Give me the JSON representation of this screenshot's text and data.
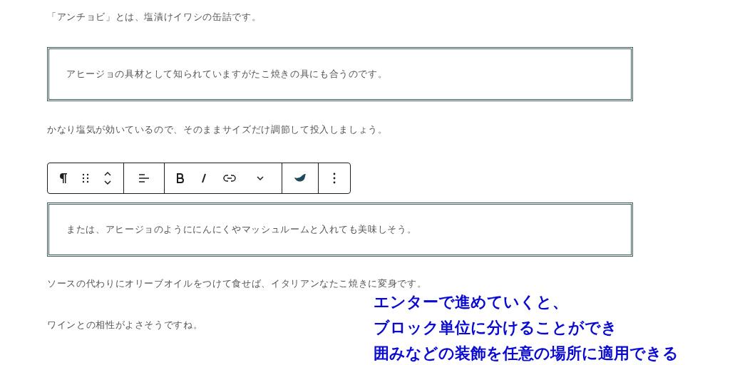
{
  "blocks": [
    {
      "kind": "paragraph",
      "text": "「アンチョビ」とは、塩漬けイワシの缶詰です。"
    },
    {
      "kind": "boxed",
      "text": "アヒージョの具材として知られていますがたこ焼きの具にも合うのです。"
    },
    {
      "kind": "paragraph",
      "text": "かなり塩気が効いているので、そのままサイズだけ調節して投入しましょう。"
    },
    {
      "kind": "toolbar"
    },
    {
      "kind": "boxed",
      "text": "または、アヒージョのようににんにくやマッシュルームと入れても美味しそう。"
    },
    {
      "kind": "paragraph",
      "text": "ソースの代わりにオリーブオイルをつけて食せば、イタリアンなたこ焼きに変身です。"
    },
    {
      "kind": "paragraph",
      "text": "ワインとの相性がよさそうですね。"
    }
  ],
  "caption": [
    "エンターで進めていくと、",
    "ブロック単位に分けることができ",
    "囲みなどの装飾を任意の場所に適用できる"
  ]
}
